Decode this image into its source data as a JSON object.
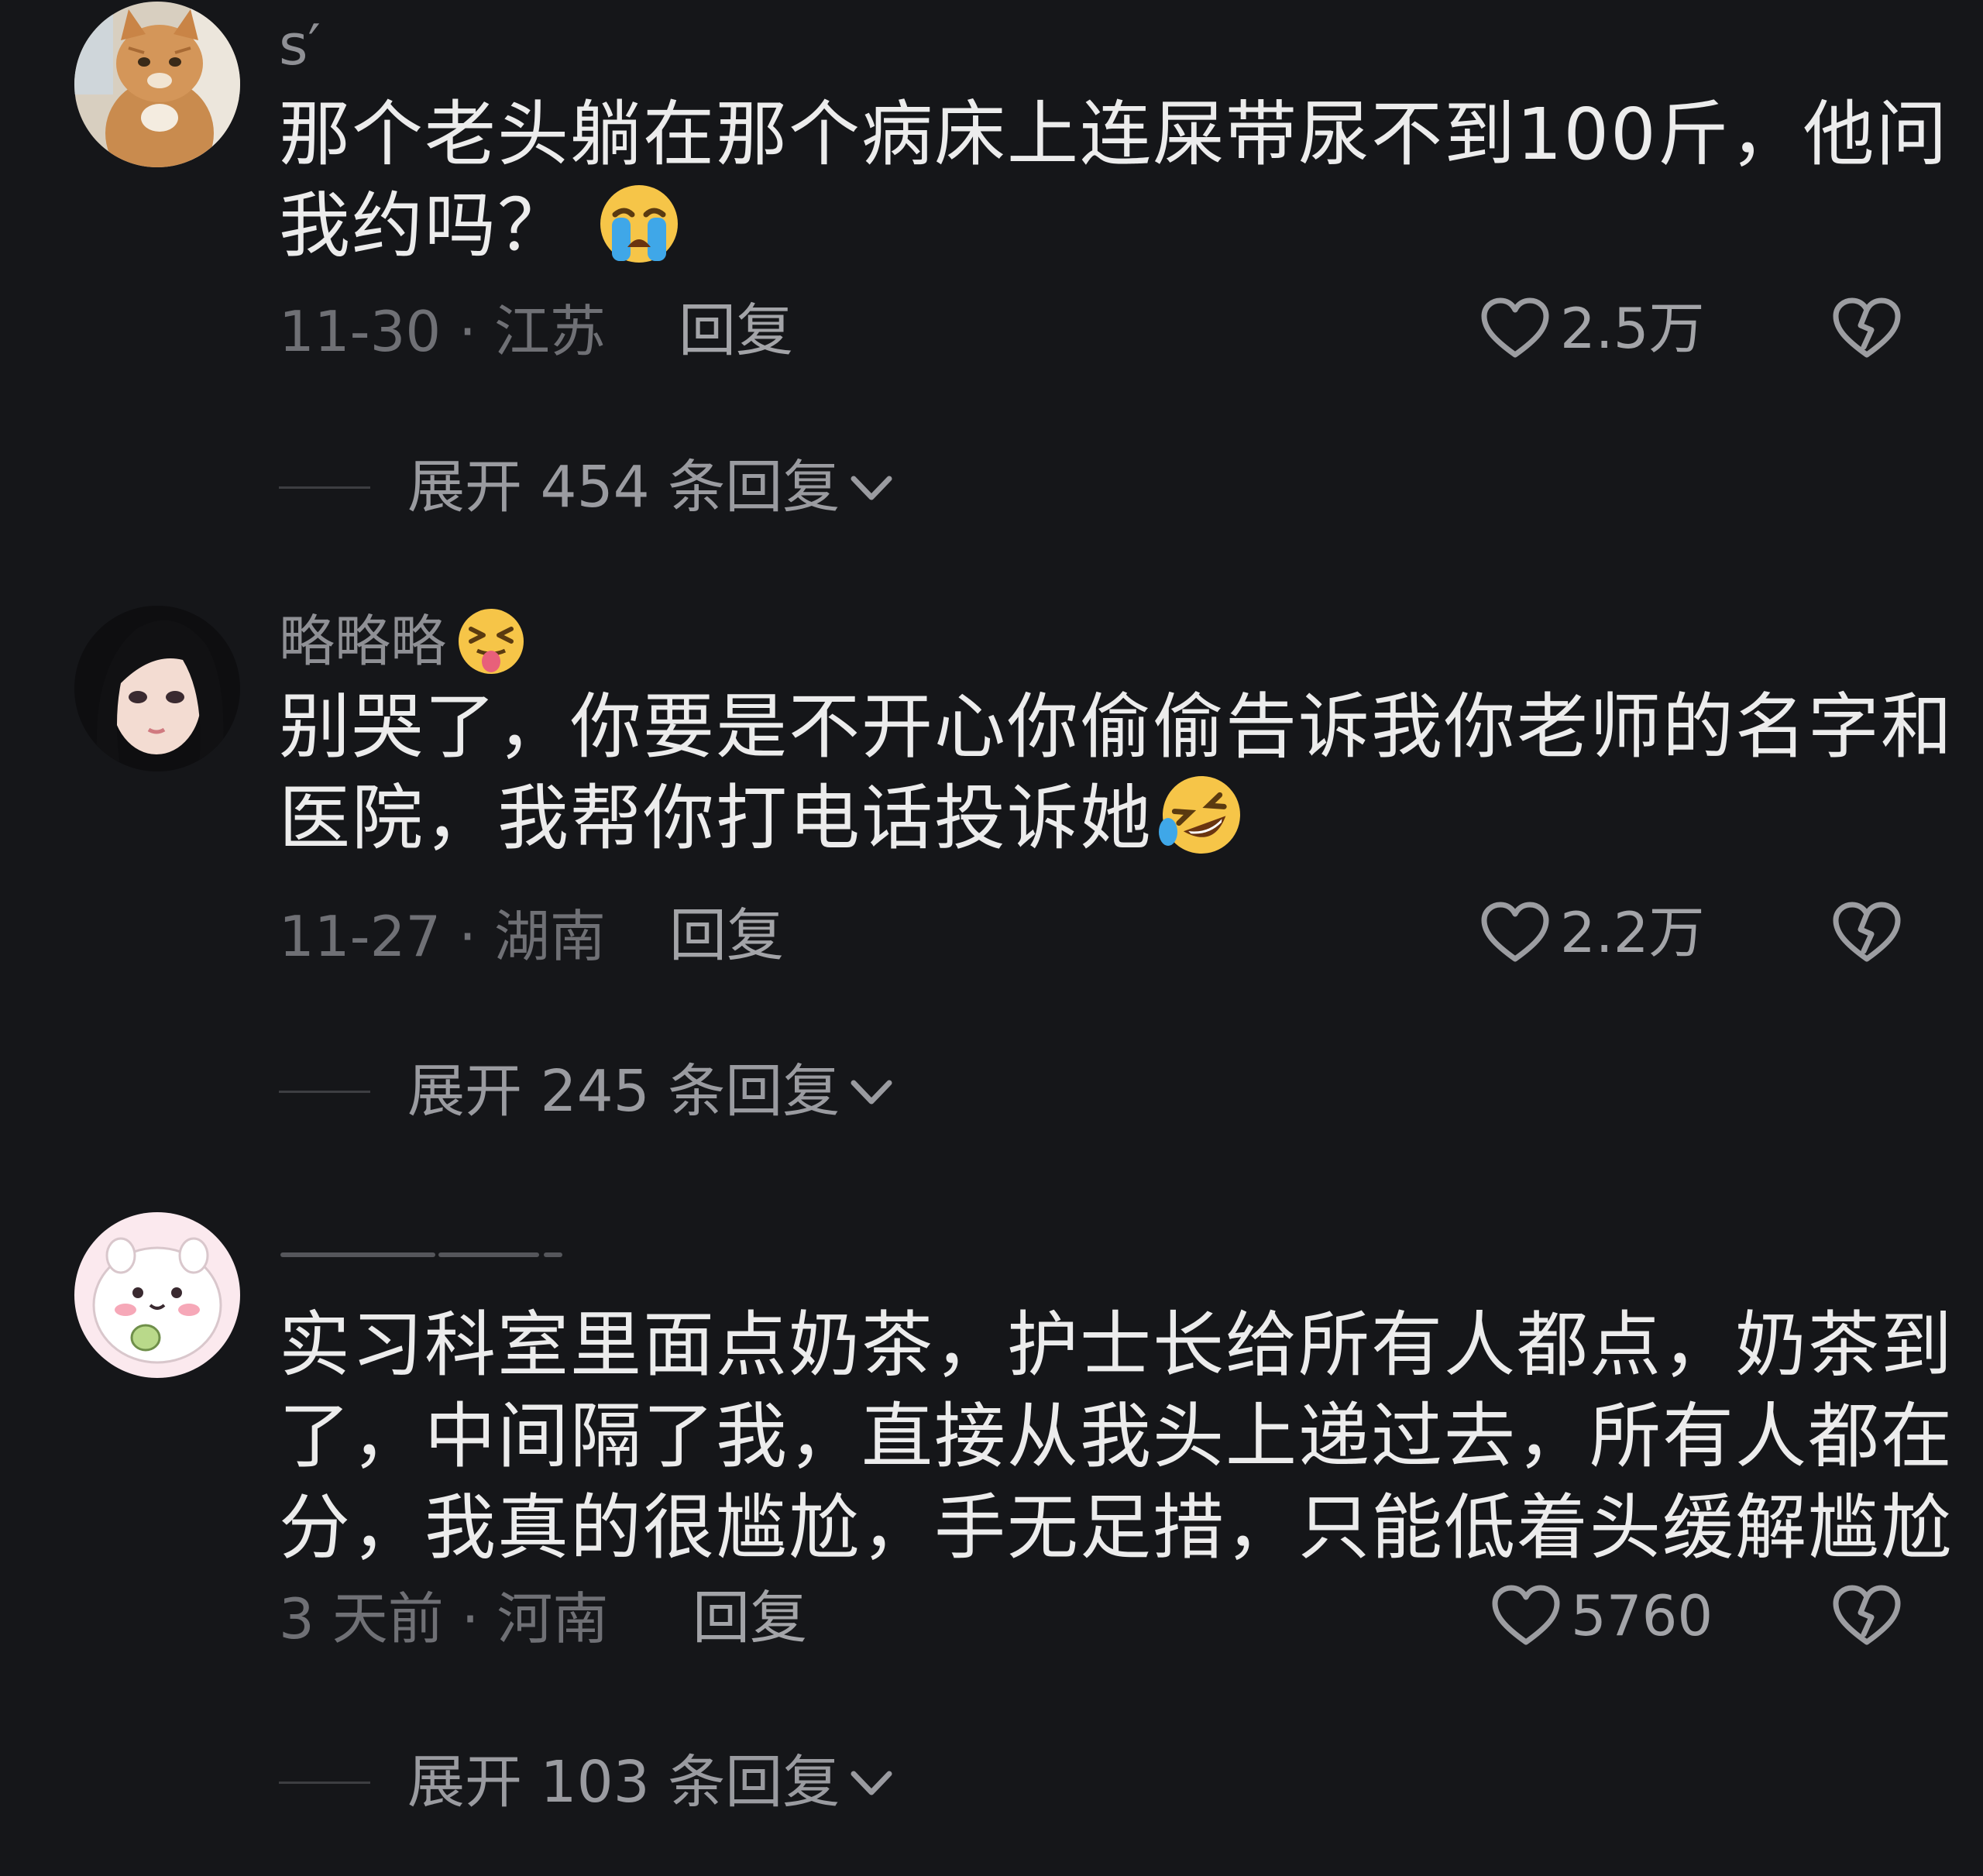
{
  "comments": [
    {
      "username": "s′",
      "avatar_icon": "orange-cat-avatar",
      "content_lines": [
        "那个老头躺在那个病床上连屎带尿不到100斤，他问",
        "我约吗？"
      ],
      "content_emoji": "loudly-crying-face-emoji",
      "date_location": "11-30 · 江苏",
      "reply_label": "回复",
      "likes": "2.5万",
      "expand_label": "展开 454 条回复"
    },
    {
      "username": "略略略",
      "username_emoji": "squinting-tongue-face-emoji",
      "avatar_icon": "anime-girl-avatar",
      "content_lines": [
        "别哭了，你要是不开心你偷偷告诉我你老师的名字和",
        "医院，我帮你打电话投诉她"
      ],
      "content_emoji": "rolling-on-floor-laughing-emoji",
      "date_location": "11-27 · 湖南",
      "reply_label": "回复",
      "likes": "2.2万",
      "expand_label": "展开 245 条回复"
    },
    {
      "username": "",
      "avatar_icon": "white-hamster-avatar",
      "content_lines": [
        "实习科室里面点奶茶，护士长给所有人都点，奶茶到",
        "了，中间隔了我，直接从我头上递过去，所有人都在",
        "分，我真的很尴尬，手无足措，只能低着头缓解尴尬"
      ],
      "date_location": "3 天前 · 河南",
      "reply_label": "回复",
      "likes": "5760",
      "expand_label": "展开 103 条回复"
    }
  ],
  "icons": {
    "like": "heart-outline-icon",
    "dislike": "broken-heart-outline-icon",
    "expand": "chevron-down-icon"
  },
  "colors": {
    "background": "#151619",
    "text_primary": "#ececec",
    "text_secondary": "#8f9095",
    "text_meta": "#6f7075"
  }
}
